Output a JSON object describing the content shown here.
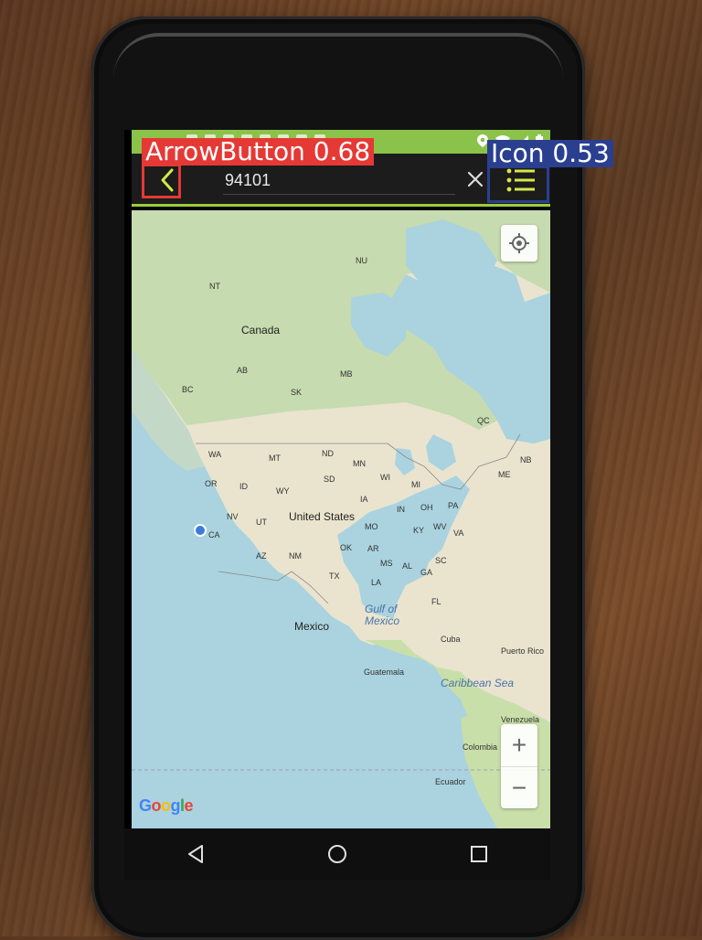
{
  "search": {
    "query": "94101"
  },
  "map": {
    "labels": {
      "nt": "NT",
      "nu": "NU",
      "canada": "Canada",
      "ab": "AB",
      "bc": "BC",
      "sk": "SK",
      "mb": "MB",
      "qc": "QC",
      "nb": "NB",
      "me": "ME",
      "wa": "WA",
      "mt": "MT",
      "nd": "ND",
      "mn": "MN",
      "or": "OR",
      "id": "ID",
      "wy": "WY",
      "sd": "SD",
      "wi": "WI",
      "mi": "MI",
      "ia": "IA",
      "nv": "NV",
      "ut": "UT",
      "united_states": "United States",
      "in": "IN",
      "oh": "OH",
      "pa": "PA",
      "ca": "CA",
      "mo": "MO",
      "ky": "KY",
      "wv": "WV",
      "va": "VA",
      "ok": "OK",
      "ar": "AR",
      "az": "AZ",
      "nm": "NM",
      "ms": "MS",
      "al": "AL",
      "ga": "GA",
      "sc": "SC",
      "tx": "TX",
      "la": "LA",
      "fl": "FL",
      "gulf": "Gulf of Mexico",
      "mexico": "Mexico",
      "cuba": "Cuba",
      "puerto_rico": "Puerto Rico",
      "guatemala": "Guatemala",
      "caribbean": "Caribbean Sea",
      "venezuela": "Venezuela",
      "colombia": "Colombia",
      "ecuador": "Ecuador"
    },
    "attribution": "Google"
  },
  "overlays": {
    "arrow_button": "ArrowButton 0.68",
    "icon": "Icon 0.53"
  },
  "colors": {
    "accent": "#8bc34a",
    "arrow_box": "#e53935",
    "icon_box": "#2a3f8f"
  }
}
